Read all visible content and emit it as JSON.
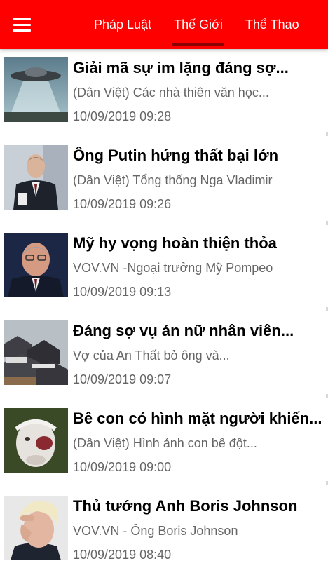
{
  "header": {
    "menu_icon": "hamburger-menu-icon",
    "tabs": [
      {
        "label": "Pháp Luật",
        "active": false
      },
      {
        "label": "Thế Giới",
        "active": true
      },
      {
        "label": "Thể Thao",
        "active": false
      }
    ],
    "colors": {
      "appbar": "#ff0000",
      "tab_indicator": "#8b0000"
    }
  },
  "articles": [
    {
      "title": "Giải mã sự im lặng đáng sợ...",
      "summary": "(Dân Việt) Các nhà thiên văn học...",
      "time": "10/09/2019 09:28",
      "thumbnail": "ufo-image"
    },
    {
      "title": "Ông Putin hứng thất bại lớn",
      "summary": "(Dân Việt) Tổng thống Nga Vladimir",
      "time": "10/09/2019 09:26",
      "thumbnail": "putin-photo"
    },
    {
      "title": "Mỹ hy vọng hoàn thiện thỏa",
      "summary": "VOV.VN -Ngoại trưởng Mỹ Pompeo",
      "time": "10/09/2019 09:13",
      "thumbnail": "pompeo-photo"
    },
    {
      "title": "Đáng sợ vụ án nữ nhân viên...",
      "summary": "Vợ của An Thất bỏ ông và...",
      "time": "10/09/2019 09:07",
      "thumbnail": "village-roofs-photo"
    },
    {
      "title": "Bê con có hình mặt người khiến...",
      "summary": "(Dân Việt) Hình ảnh con bê đột...",
      "time": "10/09/2019 09:00",
      "thumbnail": "calf-face-photo"
    },
    {
      "title": "Thủ tướng Anh Boris Johnson",
      "summary": "VOV.VN - Ông Boris Johnson",
      "time": "10/09/2019 08:40",
      "thumbnail": "boris-johnson-photo"
    }
  ]
}
